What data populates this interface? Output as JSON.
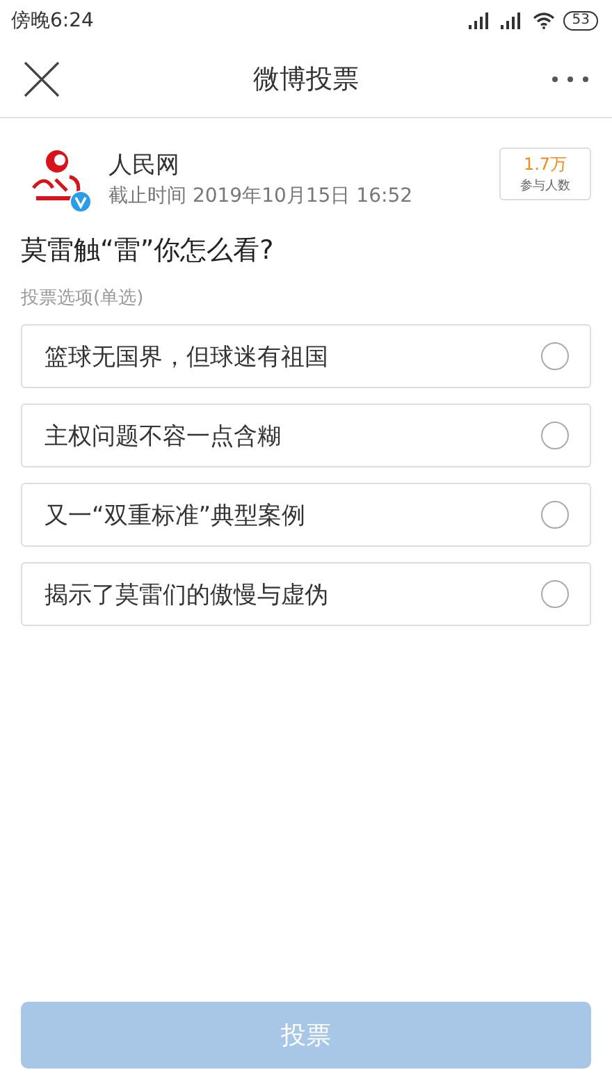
{
  "status_bar": {
    "time": "傍晚6:24",
    "battery": "53"
  },
  "nav": {
    "title": "微博投票"
  },
  "poll": {
    "author": "人民网",
    "verified": true,
    "deadline": "截止时间 2019年10月15日 16:52",
    "participants_count": "1.7万",
    "participants_label": "参与人数",
    "question": "莫雷触“雷”你怎么看?",
    "hint": "投票选项(单选)",
    "options": [
      {
        "label": "篮球无国界，但球迷有祖国",
        "selected": false
      },
      {
        "label": "主权问题不容一点含糊",
        "selected": false
      },
      {
        "label": "又一“双重标准”典型案例",
        "selected": false
      },
      {
        "label": "揭示了莫雷们的傲慢与虚伪",
        "selected": false
      }
    ]
  },
  "vote_button": {
    "label": "投票",
    "disabled": true
  }
}
